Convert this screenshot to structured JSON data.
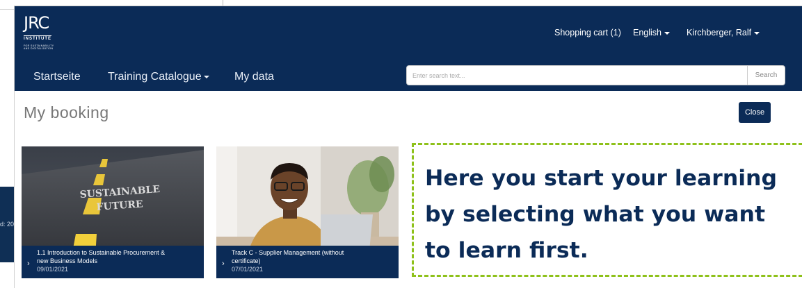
{
  "left_panel": {
    "text": "d: 20"
  },
  "logo": {
    "main": "JRC",
    "institute": "INSTITUTE",
    "sub1": "FOR SUSTAINABILITY",
    "sub2": "AND DIGITALIZATION"
  },
  "top_nav": {
    "cart_label": "Shopping cart (1)",
    "language_label": "English",
    "user_label": "Kirchberger, Ralf"
  },
  "main_nav": {
    "items": [
      {
        "label": "Startseite"
      },
      {
        "label": "Training Catalogue"
      },
      {
        "label": "My data"
      }
    ]
  },
  "search": {
    "placeholder": "Enter search text...",
    "button_label": "Search"
  },
  "page": {
    "title": "My booking",
    "close_label": "Close"
  },
  "cards": [
    {
      "title": "1.1 Introduction to Sustainable Procurement & new Business Models",
      "title_line1": "1.1 Introduction to Sustainable Procurement &",
      "title_line2": "new Business Models",
      "date": "09/01/2021",
      "image_text1": "SUSTAINABLE",
      "image_text2": "FUTURE"
    },
    {
      "title": "Track C - Supplier Management (without certificate)",
      "title_line1": "Track C - Supplier Management (without",
      "title_line2": "certificate)",
      "date": "07/01/2021"
    }
  ],
  "callout": {
    "line1": "Here you start your learning",
    "line2": "by selecting what you want",
    "line3": "to learn first."
  },
  "colors": {
    "navy": "#0b2b57",
    "callout_border": "#8ec11a",
    "muted_title": "#777777"
  }
}
